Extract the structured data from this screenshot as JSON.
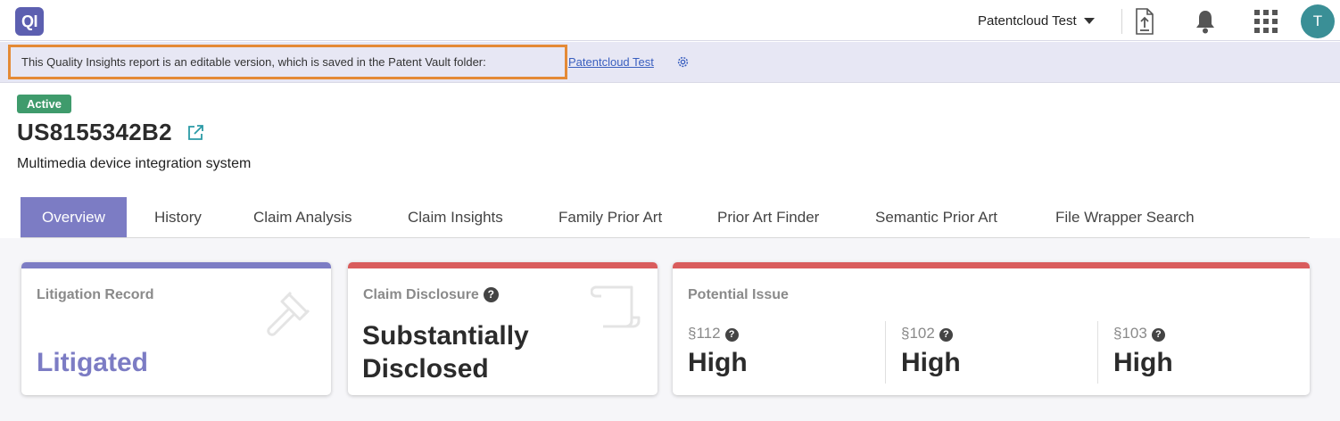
{
  "header": {
    "logo_text": "QI",
    "account_name": "Patentcloud Test",
    "avatar_initial": "T",
    "icons": [
      "document-upload-icon",
      "bell-icon",
      "apps-grid-icon"
    ]
  },
  "notice": {
    "text": "This Quality Insights report is an editable version, which is saved in the Patent Vault folder:",
    "link_text": "Patentcloud Test",
    "highlight_color": "#e48a36"
  },
  "patent": {
    "status": "Active",
    "number": "US8155342B2",
    "title": "Multimedia device integration system"
  },
  "tabs": [
    {
      "label": "Overview",
      "active": true
    },
    {
      "label": "History",
      "active": false
    },
    {
      "label": "Claim Analysis",
      "active": false
    },
    {
      "label": "Claim Insights",
      "active": false
    },
    {
      "label": "Family Prior Art",
      "active": false
    },
    {
      "label": "Prior Art Finder",
      "active": false
    },
    {
      "label": "Semantic Prior Art",
      "active": false
    },
    {
      "label": "File Wrapper Search",
      "active": false
    }
  ],
  "cards": {
    "litigation": {
      "label": "Litigation Record",
      "value": "Litigated",
      "stripe_color": "#7c7cc4"
    },
    "disclosure": {
      "label": "Claim Disclosure",
      "value": "Substantially Disclosed",
      "stripe_color": "#d95c5c"
    },
    "issue": {
      "label": "Potential Issue",
      "stripe_color": "#d95c5c",
      "columns": [
        {
          "section": "§112",
          "value": "High"
        },
        {
          "section": "§102",
          "value": "High"
        },
        {
          "section": "§103",
          "value": "High"
        }
      ]
    }
  },
  "colors": {
    "accent": "#7c7cc4",
    "active_badge": "#3f9b6c",
    "avatar": "#3a8f96",
    "logo": "#5c5fb0"
  }
}
